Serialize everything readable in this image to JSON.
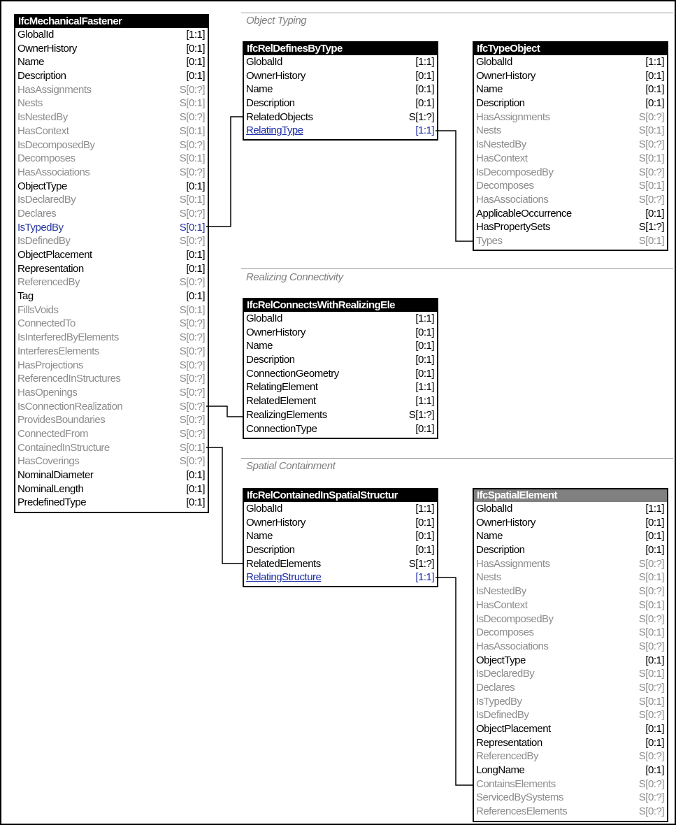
{
  "sections": [
    {
      "title": "Object Typing"
    },
    {
      "title": "Realizing Connectivity"
    },
    {
      "title": "Spatial Containment"
    }
  ],
  "entities": [
    {
      "title": "IfcMechanicalFastener",
      "attributes": [
        {
          "name": "GlobalId",
          "card": "[1:1]",
          "style": "b"
        },
        {
          "name": "OwnerHistory",
          "card": "[0:1]",
          "style": "b"
        },
        {
          "name": "Name",
          "card": "[0:1]",
          "style": "b"
        },
        {
          "name": "Description",
          "card": "[0:1]",
          "style": "b"
        },
        {
          "name": "HasAssignments",
          "card": "S[0:?]",
          "style": "g"
        },
        {
          "name": "Nests",
          "card": "S[0:1]",
          "style": "g"
        },
        {
          "name": "IsNestedBy",
          "card": "S[0:?]",
          "style": "g"
        },
        {
          "name": "HasContext",
          "card": "S[0:1]",
          "style": "g"
        },
        {
          "name": "IsDecomposedBy",
          "card": "S[0:?]",
          "style": "g"
        },
        {
          "name": "Decomposes",
          "card": "S[0:1]",
          "style": "g"
        },
        {
          "name": "HasAssociations",
          "card": "S[0:?]",
          "style": "g"
        },
        {
          "name": "ObjectType",
          "card": "[0:1]",
          "style": "b"
        },
        {
          "name": "IsDeclaredBy",
          "card": "S[0:1]",
          "style": "g"
        },
        {
          "name": "Declares",
          "card": "S[0:?]",
          "style": "g"
        },
        {
          "name": "IsTypedBy",
          "card": "S[0:1]",
          "style": "lp"
        },
        {
          "name": "IsDefinedBy",
          "card": "S[0:?]",
          "style": "g"
        },
        {
          "name": "ObjectPlacement",
          "card": "[0:1]",
          "style": "b"
        },
        {
          "name": "Representation",
          "card": "[0:1]",
          "style": "b"
        },
        {
          "name": "ReferencedBy",
          "card": "S[0:?]",
          "style": "g"
        },
        {
          "name": "Tag",
          "card": "[0:1]",
          "style": "b"
        },
        {
          "name": "FillsVoids",
          "card": "S[0:1]",
          "style": "g"
        },
        {
          "name": "ConnectedTo",
          "card": "S[0:?]",
          "style": "g"
        },
        {
          "name": "IsInterferedByElements",
          "card": "S[0:?]",
          "style": "g"
        },
        {
          "name": "InterferesElements",
          "card": "S[0:?]",
          "style": "g"
        },
        {
          "name": "HasProjections",
          "card": "S[0:?]",
          "style": "g"
        },
        {
          "name": "ReferencedInStructures",
          "card": "S[0:?]",
          "style": "g"
        },
        {
          "name": "HasOpenings",
          "card": "S[0:?]",
          "style": "g"
        },
        {
          "name": "IsConnectionRealization",
          "card": "S[0:?]",
          "style": "g"
        },
        {
          "name": "ProvidesBoundaries",
          "card": "S[0:?]",
          "style": "g"
        },
        {
          "name": "ConnectedFrom",
          "card": "S[0:?]",
          "style": "g"
        },
        {
          "name": "ContainedInStructure",
          "card": "S[0:1]",
          "style": "g"
        },
        {
          "name": "HasCoverings",
          "card": "S[0:?]",
          "style": "g"
        },
        {
          "name": "NominalDiameter",
          "card": "[0:1]",
          "style": "b"
        },
        {
          "name": "NominalLength",
          "card": "[0:1]",
          "style": "b"
        },
        {
          "name": "PredefinedType",
          "card": "[0:1]",
          "style": "b"
        }
      ]
    },
    {
      "title": "IfcRelDefinesByType",
      "attributes": [
        {
          "name": "GlobalId",
          "card": "[1:1]",
          "style": "b"
        },
        {
          "name": "OwnerHistory",
          "card": "[0:1]",
          "style": "b"
        },
        {
          "name": "Name",
          "card": "[0:1]",
          "style": "b"
        },
        {
          "name": "Description",
          "card": "[0:1]",
          "style": "b"
        },
        {
          "name": "RelatedObjects",
          "card": "S[1:?]",
          "style": "b"
        },
        {
          "name": "RelatingType",
          "card": "[1:1]",
          "style": "l"
        }
      ]
    },
    {
      "title": "IfcTypeObject",
      "attributes": [
        {
          "name": "GlobalId",
          "card": "[1:1]",
          "style": "b"
        },
        {
          "name": "OwnerHistory",
          "card": "[0:1]",
          "style": "b"
        },
        {
          "name": "Name",
          "card": "[0:1]",
          "style": "b"
        },
        {
          "name": "Description",
          "card": "[0:1]",
          "style": "b"
        },
        {
          "name": "HasAssignments",
          "card": "S[0:?]",
          "style": "g"
        },
        {
          "name": "Nests",
          "card": "S[0:1]",
          "style": "g"
        },
        {
          "name": "IsNestedBy",
          "card": "S[0:?]",
          "style": "g"
        },
        {
          "name": "HasContext",
          "card": "S[0:1]",
          "style": "g"
        },
        {
          "name": "IsDecomposedBy",
          "card": "S[0:?]",
          "style": "g"
        },
        {
          "name": "Decomposes",
          "card": "S[0:1]",
          "style": "g"
        },
        {
          "name": "HasAssociations",
          "card": "S[0:?]",
          "style": "g"
        },
        {
          "name": "ApplicableOccurrence",
          "card": "[0:1]",
          "style": "b"
        },
        {
          "name": "HasPropertySets",
          "card": "S[1:?]",
          "style": "b"
        },
        {
          "name": "Types",
          "card": "S[0:1]",
          "style": "g"
        }
      ]
    },
    {
      "title": "IfcRelConnectsWithRealizingEle",
      "attributes": [
        {
          "name": "GlobalId",
          "card": "[1:1]",
          "style": "b"
        },
        {
          "name": "OwnerHistory",
          "card": "[0:1]",
          "style": "b"
        },
        {
          "name": "Name",
          "card": "[0:1]",
          "style": "b"
        },
        {
          "name": "Description",
          "card": "[0:1]",
          "style": "b"
        },
        {
          "name": "ConnectionGeometry",
          "card": "[0:1]",
          "style": "b"
        },
        {
          "name": "RelatingElement",
          "card": "[1:1]",
          "style": "b"
        },
        {
          "name": "RelatedElement",
          "card": "[1:1]",
          "style": "b"
        },
        {
          "name": "RealizingElements",
          "card": "S[1:?]",
          "style": "b"
        },
        {
          "name": "ConnectionType",
          "card": "[0:1]",
          "style": "b"
        }
      ]
    },
    {
      "title": "IfcRelContainedInSpatialStructur",
      "attributes": [
        {
          "name": "GlobalId",
          "card": "[1:1]",
          "style": "b"
        },
        {
          "name": "OwnerHistory",
          "card": "[0:1]",
          "style": "b"
        },
        {
          "name": "Name",
          "card": "[0:1]",
          "style": "b"
        },
        {
          "name": "Description",
          "card": "[0:1]",
          "style": "b"
        },
        {
          "name": "RelatedElements",
          "card": "S[1:?]",
          "style": "b"
        },
        {
          "name": "RelatingStructure",
          "card": "[1:1]",
          "style": "l"
        }
      ]
    },
    {
      "title": "IfcSpatialElement",
      "header": "gray",
      "attributes": [
        {
          "name": "GlobalId",
          "card": "[1:1]",
          "style": "b"
        },
        {
          "name": "OwnerHistory",
          "card": "[0:1]",
          "style": "b"
        },
        {
          "name": "Name",
          "card": "[0:1]",
          "style": "b"
        },
        {
          "name": "Description",
          "card": "[0:1]",
          "style": "b"
        },
        {
          "name": "HasAssignments",
          "card": "S[0:?]",
          "style": "g"
        },
        {
          "name": "Nests",
          "card": "S[0:1]",
          "style": "g"
        },
        {
          "name": "IsNestedBy",
          "card": "S[0:?]",
          "style": "g"
        },
        {
          "name": "HasContext",
          "card": "S[0:1]",
          "style": "g"
        },
        {
          "name": "IsDecomposedBy",
          "card": "S[0:?]",
          "style": "g"
        },
        {
          "name": "Decomposes",
          "card": "S[0:1]",
          "style": "g"
        },
        {
          "name": "HasAssociations",
          "card": "S[0:?]",
          "style": "g"
        },
        {
          "name": "ObjectType",
          "card": "[0:1]",
          "style": "b"
        },
        {
          "name": "IsDeclaredBy",
          "card": "S[0:1]",
          "style": "g"
        },
        {
          "name": "Declares",
          "card": "S[0:?]",
          "style": "g"
        },
        {
          "name": "IsTypedBy",
          "card": "S[0:1]",
          "style": "g"
        },
        {
          "name": "IsDefinedBy",
          "card": "S[0:?]",
          "style": "g"
        },
        {
          "name": "ObjectPlacement",
          "card": "[0:1]",
          "style": "b"
        },
        {
          "name": "Representation",
          "card": "[0:1]",
          "style": "b"
        },
        {
          "name": "ReferencedBy",
          "card": "S[0:?]",
          "style": "g"
        },
        {
          "name": "LongName",
          "card": "[0:1]",
          "style": "b"
        },
        {
          "name": "ContainsElements",
          "card": "S[0:?]",
          "style": "g"
        },
        {
          "name": "ServicedBySystems",
          "card": "S[0:?]",
          "style": "g"
        },
        {
          "name": "ReferencesElements",
          "card": "S[0:?]",
          "style": "g"
        }
      ]
    }
  ]
}
